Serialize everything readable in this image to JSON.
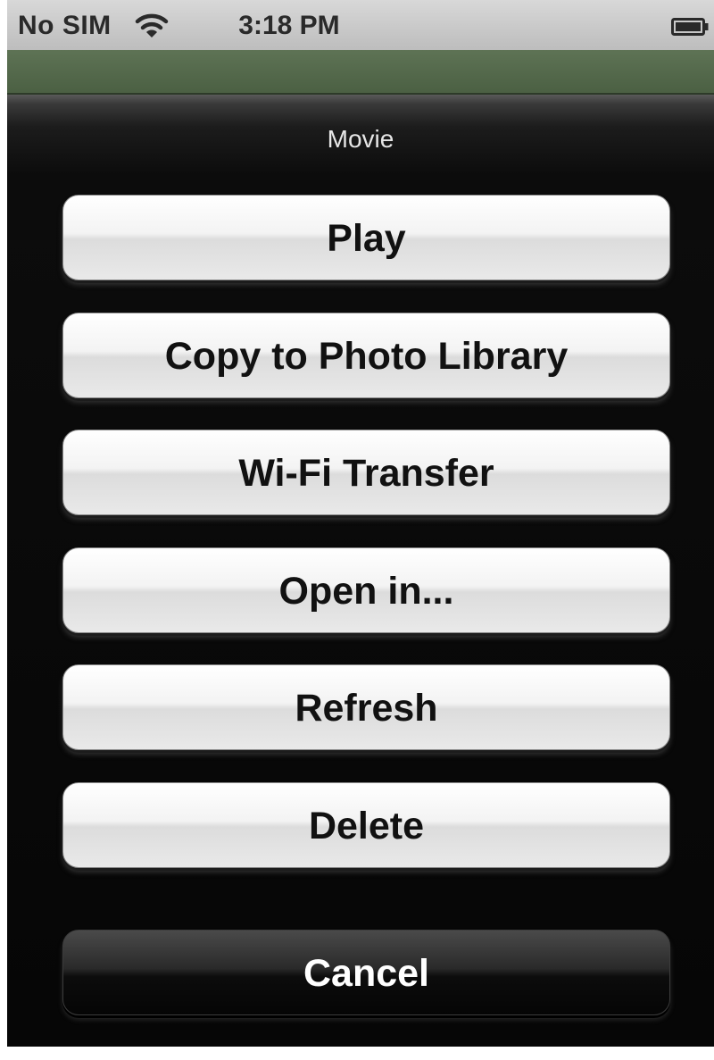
{
  "status_bar": {
    "carrier": "No SIM",
    "time": "3:18 PM",
    "wifi_icon": "wifi-icon",
    "battery_icon": "battery-icon"
  },
  "action_sheet": {
    "title": "Movie",
    "buttons": [
      {
        "label": "Play"
      },
      {
        "label": "Copy to Photo Library"
      },
      {
        "label": "Wi-Fi Transfer"
      },
      {
        "label": "Open in..."
      },
      {
        "label": "Refresh"
      },
      {
        "label": "Delete"
      }
    ],
    "cancel_label": "Cancel"
  },
  "colors": {
    "nav_strip": "#566b4d",
    "sheet_background": "#000000",
    "button_light": "#e9e9e9",
    "button_dark": "#1a1a1a"
  }
}
